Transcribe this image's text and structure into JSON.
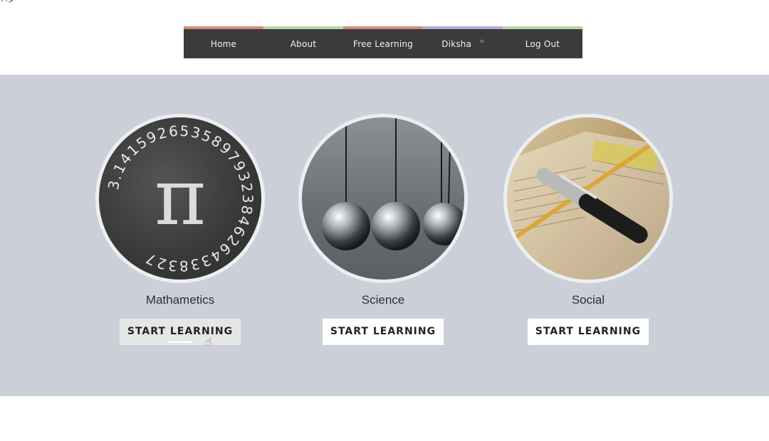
{
  "stray_text": "-->",
  "nav": {
    "items": [
      {
        "label": "Home",
        "accent": "#d88a7a"
      },
      {
        "label": "About",
        "accent": "#b6d9a3"
      },
      {
        "label": "Free Learning",
        "accent": "#d88a7a"
      },
      {
        "label": "Diksha",
        "accent": "#b8a6d9",
        "caret": "▫"
      },
      {
        "label": "Log Out",
        "accent": "#b6d9a3"
      }
    ]
  },
  "subjects": [
    {
      "title": "Mathametics",
      "button": "START LEARNING"
    },
    {
      "title": "Science",
      "button": "START LEARNING"
    },
    {
      "title": "Social",
      "button": "START LEARNING"
    }
  ],
  "math_art": {
    "symbol": "π",
    "digits": "3.14159265358979323846264338327"
  },
  "colors": {
    "band": "#cbd0d8",
    "nav": "#3b3b3b"
  }
}
